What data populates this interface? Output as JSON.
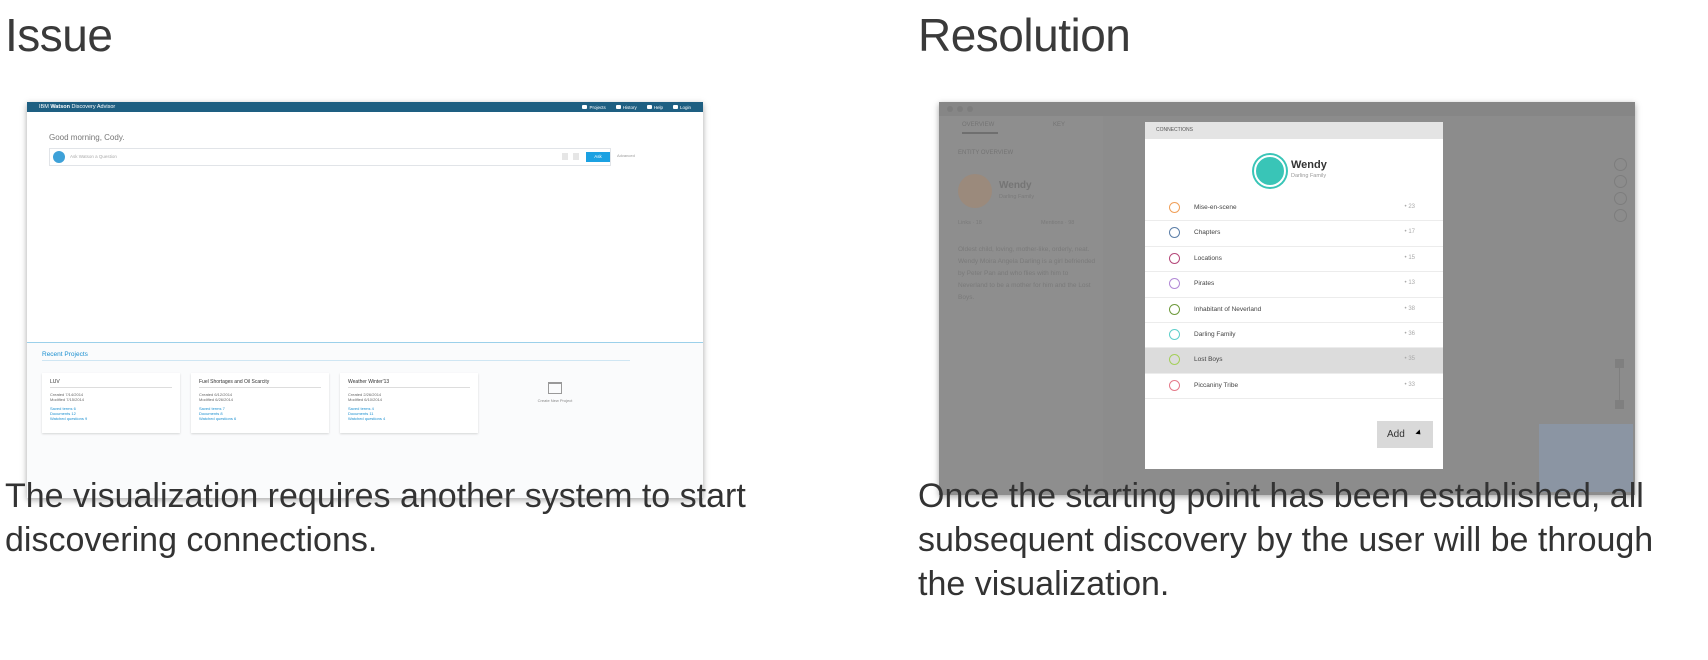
{
  "left": {
    "heading": "Issue",
    "caption_line1": "The visualization requires another system to start",
    "caption_line2": "discovering connections.",
    "screenshot": {
      "brand_prefix": "IBM ",
      "brand_strong": "Watson",
      "brand_suffix": " Discovery Advisor",
      "nav": [
        "Projects",
        "History",
        "Help",
        "Login"
      ],
      "greeting": "Good morning, Cody.",
      "ask_placeholder": "Ask Watson a Question",
      "ask_button": "Ask",
      "ask_extra": "Advanced",
      "recent_title": "Recent Projects",
      "projects": [
        {
          "title": "LUV",
          "created": "Created 7/14/2014",
          "modified": "Modified 7/15/2014",
          "saved": "Saved terms 6",
          "docs": "Documents 12",
          "watched": "Watched questions 9"
        },
        {
          "title": "Fuel Shortages and Oil Scarcity",
          "created": "Created 6/12/2014",
          "modified": "Modified 6/26/2014",
          "saved": "Saved terms 7",
          "docs": "Documents 8",
          "watched": "Watched questions 6"
        },
        {
          "title": "Weather Winter'13",
          "created": "Created 2/26/2014",
          "modified": "Modified 6/10/2014",
          "saved": "Saved terms 4",
          "docs": "Documents 11",
          "watched": "Watched questions 4"
        }
      ],
      "new_project": "Create New Project"
    }
  },
  "right": {
    "heading": "Resolution",
    "caption_line1": "Once the starting point has been established, all",
    "caption_line2": "subsequent discovery by the user will be through",
    "caption_line3": "the visualization.",
    "screenshot": {
      "tabs": [
        "OVERVIEW",
        "KEY"
      ],
      "entity_overview": "ENTITY OVERVIEW",
      "entity_name": "Wendy",
      "entity_family": "Darling Family",
      "links": "Links · 18",
      "mentions": "Mentions · 98",
      "description": "Oldest child, loving, mother-like, orderly, neat. Wendy Moira Angela Darling is a girl befriended by Peter Pan and who flies with him to Neverland to be a mother for him and the Lost Boys.",
      "dialog_title": "CONNECTIONS",
      "center_name": "Wendy",
      "center_sub": "Darling Family",
      "center_color": "#39c5b7",
      "connections": [
        {
          "label": "Mise-en-scene",
          "count": "• 23",
          "color": "#f0a05a"
        },
        {
          "label": "Chapters",
          "count": "• 17",
          "color": "#5c7fa8"
        },
        {
          "label": "Locations",
          "count": "• 15",
          "color": "#b5487a"
        },
        {
          "label": "Pirates",
          "count": "• 13",
          "color": "#b28ad6"
        },
        {
          "label": "Inhabitant of Neverland",
          "count": "• 38",
          "color": "#6e9a3c"
        },
        {
          "label": "Darling Family",
          "count": "• 36",
          "color": "#5fcfcb"
        },
        {
          "label": "Lost Boys",
          "count": "• 35",
          "color": "#a4cf5a"
        },
        {
          "label": "Piccaniny Tribe",
          "count": "• 33",
          "color": "#e57a8a"
        }
      ],
      "selected_index": 6,
      "add_button": "Add"
    }
  }
}
